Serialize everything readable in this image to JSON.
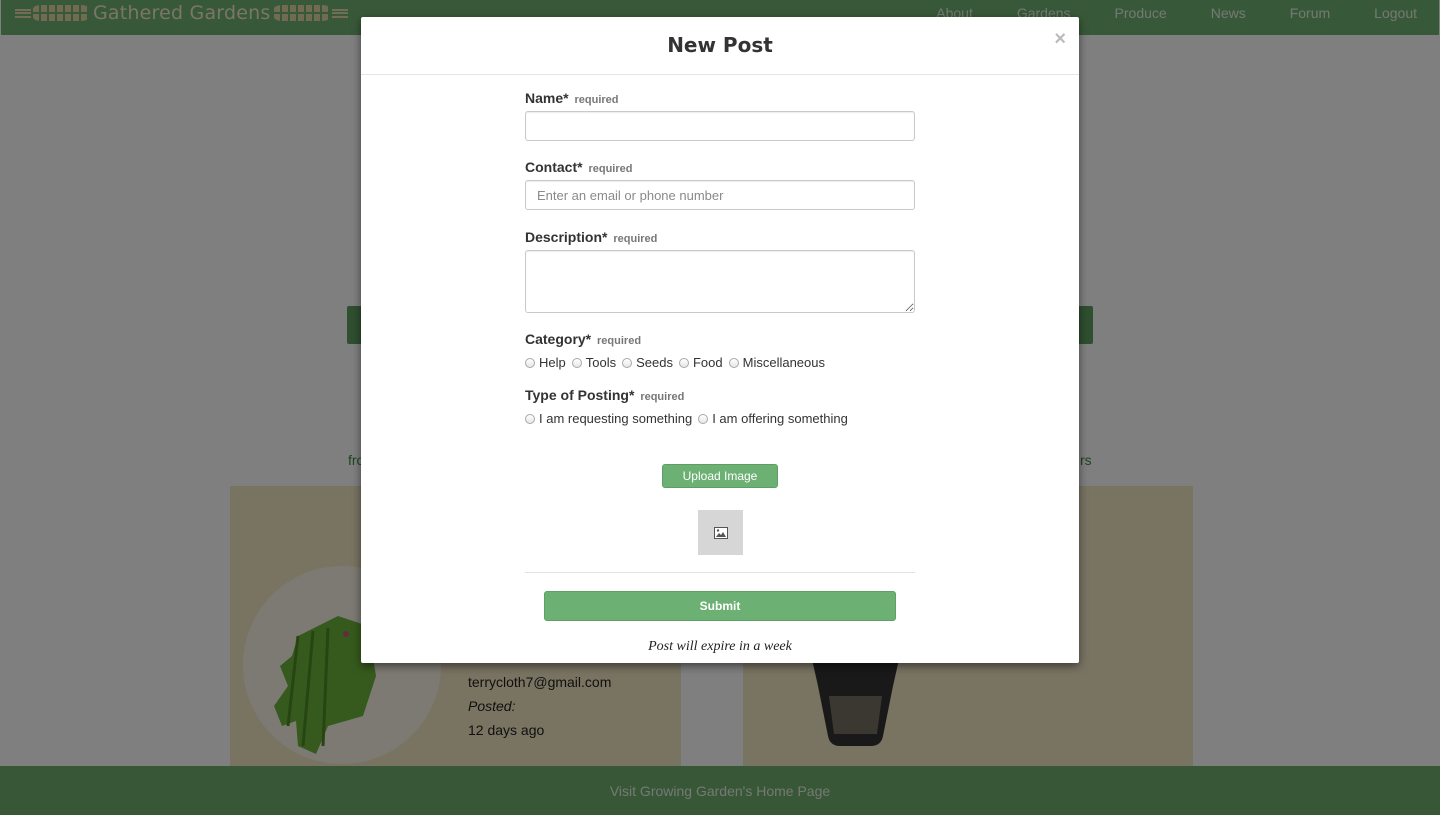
{
  "header": {
    "brand": "Gathered Gardens",
    "nav": [
      "About",
      "Gardens",
      "Produce",
      "News",
      "Forum",
      "Logout"
    ]
  },
  "background": {
    "side_left": "fro",
    "side_right": "rs",
    "card_left": {
      "contact": "terrycloth7@gmail.com",
      "posted_label": "Posted:",
      "posted_value": "12 days ago"
    }
  },
  "footer": {
    "link": "Visit Growing Garden's Home Page"
  },
  "modal": {
    "title": "New Post",
    "close": "×",
    "required_text": "required",
    "fields": {
      "name": {
        "label": "Name*",
        "value": ""
      },
      "contact": {
        "label": "Contact*",
        "placeholder": "Enter an email or phone number",
        "value": ""
      },
      "description": {
        "label": "Description*",
        "value": ""
      },
      "category": {
        "label": "Category*",
        "options": [
          "Help",
          "Tools",
          "Seeds",
          "Food",
          "Miscellaneous"
        ]
      },
      "posting_type": {
        "label": "Type of Posting*",
        "options": [
          "I am requesting something",
          "I am offering something"
        ]
      }
    },
    "upload_label": "Upload Image",
    "submit_label": "Submit",
    "expire_note": "Post will expire in a week"
  },
  "colors": {
    "brand_green": "#71b373",
    "button_green": "#6cb073",
    "card_tan": "#f3e6c4"
  }
}
